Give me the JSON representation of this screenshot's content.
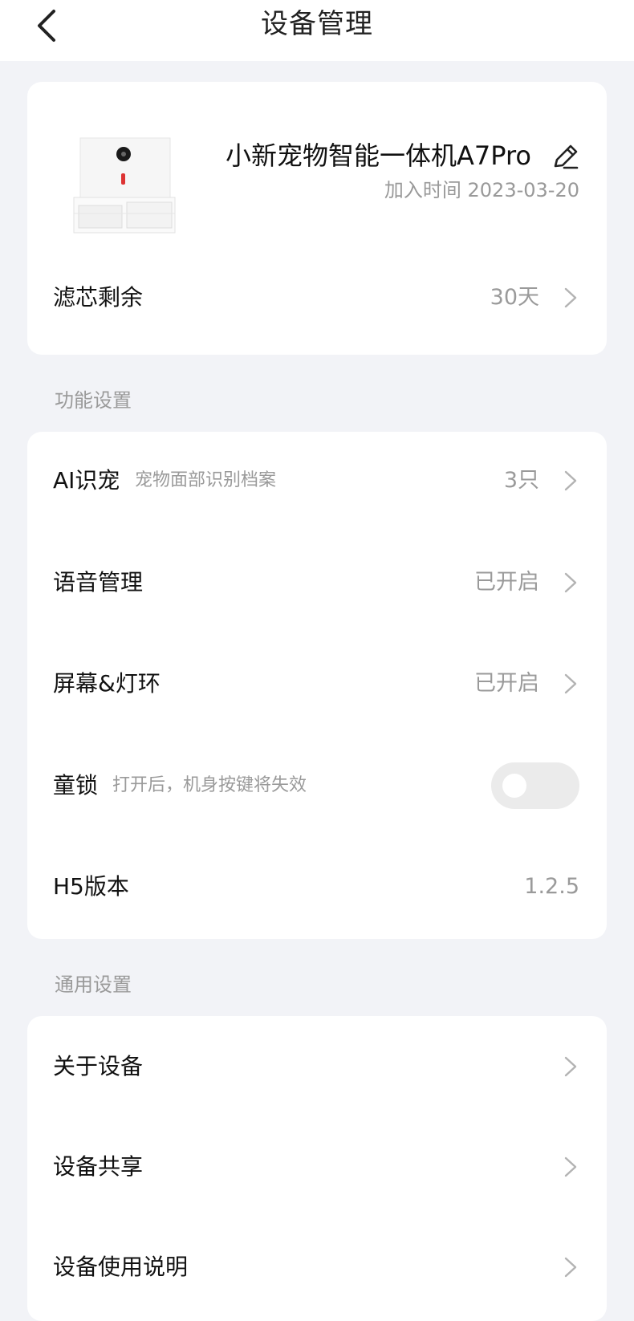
{
  "header": {
    "title": "设备管理"
  },
  "device": {
    "name": "小新宠物智能一体机A7Pro",
    "join_time": "加入时间 2023-03-20",
    "filter_label": "滤芯剩余",
    "filter_value": "30天"
  },
  "function_settings": {
    "section_title": "功能设置",
    "ai_pet": {
      "label": "AI识宠",
      "sub": "宠物面部识别档案",
      "value": "3只"
    },
    "voice": {
      "label": "语音管理",
      "value": "已开启"
    },
    "screen_light": {
      "label": "屏幕&灯环",
      "value": "已开启"
    },
    "child_lock": {
      "label": "童锁",
      "sub": "打开后，机身按键将失效",
      "enabled": false
    },
    "h5_version": {
      "label": "H5版本",
      "value": "1.2.5"
    }
  },
  "general_settings": {
    "section_title": "通用设置",
    "items": [
      {
        "label": "关于设备"
      },
      {
        "label": "设备共享"
      },
      {
        "label": "设备使用说明"
      }
    ]
  },
  "colors": {
    "background": "#f2f3f7",
    "card": "#ffffff",
    "secondary_text": "#9a9a9a"
  }
}
